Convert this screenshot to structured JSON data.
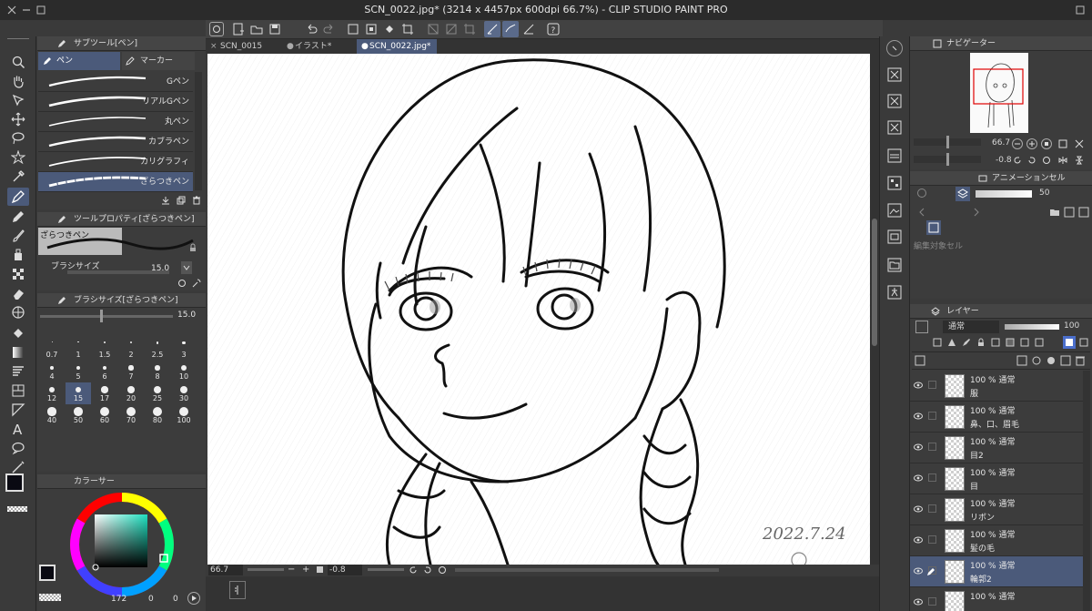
{
  "app": {
    "title": "SCN_0022.jpg* (3214 x 4457px 600dpi 66.7%)  - CLIP STUDIO PAINT PRO"
  },
  "tabs": [
    {
      "label": "SCN_0015"
    },
    {
      "label": "イラスト*"
    },
    {
      "label": "SCN_0022.jpg*"
    }
  ],
  "subtool": {
    "title": "サブツール[ペン]",
    "tab_pen": "ペン",
    "tab_marker": "マーカー",
    "brushes": [
      {
        "label": "Gペン"
      },
      {
        "label": "リアルGペン"
      },
      {
        "label": "丸ペン"
      },
      {
        "label": "カブラペン"
      },
      {
        "label": "カリグラフィ"
      },
      {
        "label": "ざらつきペン"
      }
    ]
  },
  "toolprop": {
    "title": "ツールプロパティ[ざらつきペン]",
    "preview_label": "ざらつきペン",
    "brush_size_label": "ブラシサイズ",
    "brush_size_value": "15.0"
  },
  "brushsize": {
    "title": "ブラシサイズ[ざらつきペン]",
    "value": "15.0",
    "sizes": [
      "0.7",
      "1",
      "1.5",
      "2",
      "2.5",
      "3",
      "4",
      "5",
      "6",
      "7",
      "8",
      "10",
      "12",
      "15",
      "17",
      "20",
      "25",
      "30",
      "40",
      "50",
      "60",
      "70",
      "80",
      "100"
    ],
    "selected": "15"
  },
  "color": {
    "title": "カラーサー",
    "main": "#0a0a12",
    "sub": "#2a2a2a",
    "readout": {
      "h": "172",
      "s": "0",
      "v": "0"
    }
  },
  "status": {
    "zoom": "66.7",
    "angle": "-0.8"
  },
  "navigator": {
    "title": "ナビゲーター",
    "zoom": "66.7",
    "angle": "-0.8"
  },
  "animation": {
    "title": "アニメーションセル",
    "value": "50",
    "empty_label": "編集対象セル"
  },
  "layers": {
    "title": "レイヤー",
    "blend": "通常",
    "opacity": "100",
    "items": [
      {
        "pct": "100 %  通常",
        "name": "服",
        "selected": false
      },
      {
        "pct": "100 %  通常",
        "name": "鼻、口、眉毛",
        "selected": false
      },
      {
        "pct": "100 %  通常",
        "name": "目2",
        "selected": false
      },
      {
        "pct": "100 %  通常",
        "name": "目",
        "selected": false
      },
      {
        "pct": "100 %  通常",
        "name": "リボン",
        "selected": false
      },
      {
        "pct": "100 %  通常",
        "name": "髪の毛",
        "selected": false
      },
      {
        "pct": "100 %  通常",
        "name": "輪郭2",
        "selected": true
      },
      {
        "pct": "100 %  通常",
        "name": "",
        "selected": false
      }
    ]
  },
  "sketch": {
    "date": "2022.7.24"
  }
}
